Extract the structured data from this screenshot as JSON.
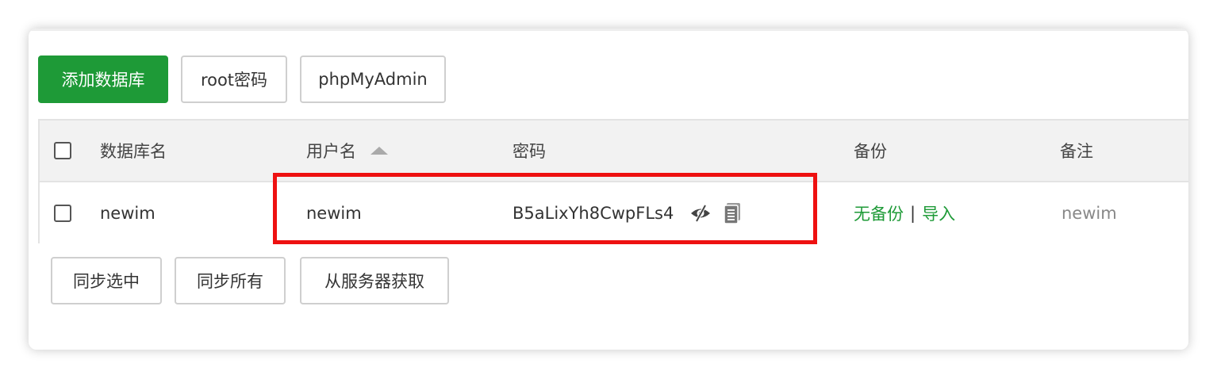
{
  "toolbar": {
    "add_db_label": "添加数据库",
    "root_pw_label": "root密码",
    "phpmyadmin_label": "phpMyAdmin"
  },
  "table": {
    "headers": {
      "db_name": "数据库名",
      "username": "用户名",
      "password": "密码",
      "backup": "备份",
      "note": "备注"
    },
    "rows": [
      {
        "db_name": "newim",
        "username": "newim",
        "password": "B5aLixYh8CwpFLs4",
        "backup_status": "无备份",
        "separator": "|",
        "import_label": "导入",
        "note": "newim"
      }
    ]
  },
  "footer": {
    "sync_selected_label": "同步选中",
    "sync_all_label": "同步所有",
    "fetch_from_server_label": "从服务器获取"
  },
  "icons": {
    "show_password": "eye-slash-icon",
    "copy_password": "clipboard-copy-icon",
    "sort": "sort-ascending-icon"
  },
  "colors": {
    "primary": "#1e9a37",
    "highlight_border": "#ee1111"
  }
}
